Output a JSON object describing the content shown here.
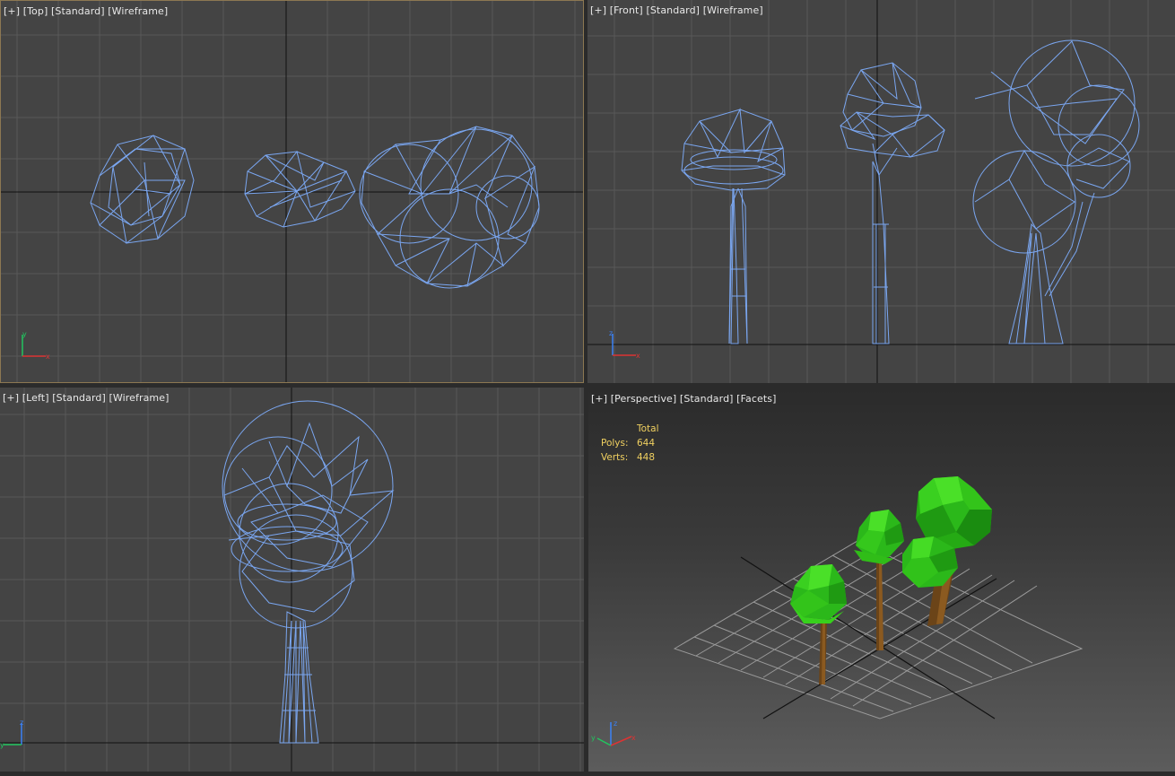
{
  "viewports": {
    "top": {
      "plus": "[+]",
      "view": "[Top]",
      "mode": "[Standard]",
      "shading": "[Wireframe]"
    },
    "front": {
      "plus": "[+]",
      "view": "[Front]",
      "mode": "[Standard]",
      "shading": "[Wireframe]"
    },
    "left": {
      "plus": "[+]",
      "view": "[Left]",
      "mode": "[Standard]",
      "shading": "[Wireframe]"
    },
    "persp": {
      "plus": "[+]",
      "view": "[Perspective]",
      "mode": "[Standard]",
      "shading": "[Facets]"
    }
  },
  "stats": {
    "header": "Total",
    "polys_label": "Polys:",
    "polys_value": "644",
    "verts_label": "Verts:",
    "verts_value": "448"
  },
  "axes": {
    "x": "x",
    "y": "y",
    "z": "z"
  },
  "colors": {
    "wire": "#7aa6f0",
    "grid": "#5a5a5a",
    "axis_line": "#111111",
    "active_border": "#8c7852",
    "foliage": "#33cc1a",
    "trunk": "#7a5220",
    "stats_text": "#f0d060"
  }
}
